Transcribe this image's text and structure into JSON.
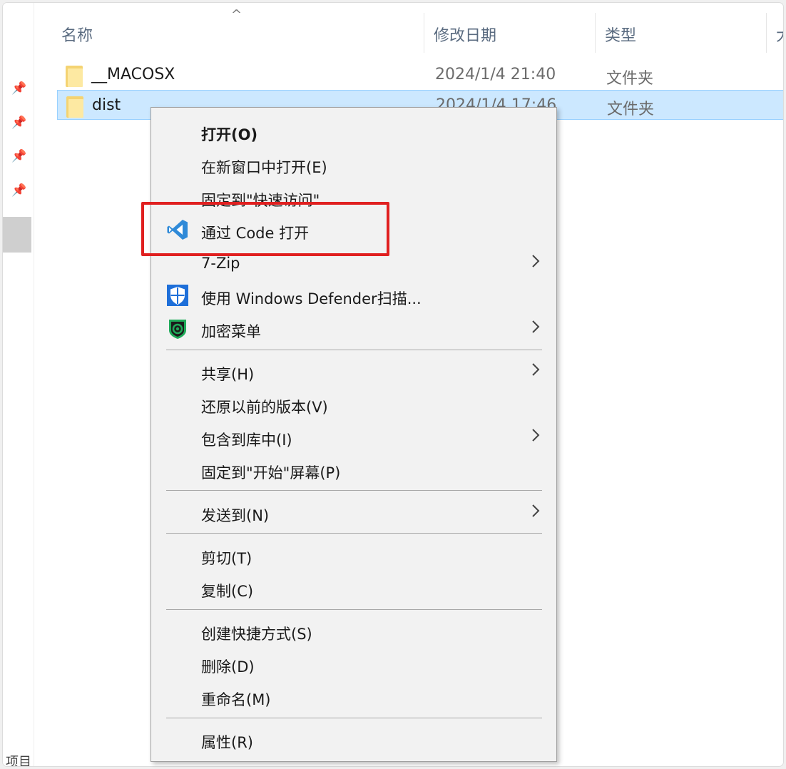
{
  "columns": {
    "name": "名称",
    "date": "修改日期",
    "type": "类型",
    "size_cut": "大"
  },
  "files": [
    {
      "name": "__MACOSX",
      "date": "2024/1/4 21:40",
      "type": "文件夹",
      "selected": false
    },
    {
      "name": "dist",
      "date": "2024/1/4 17:46",
      "type": "文件夹",
      "selected": true
    }
  ],
  "nav_cut_text": "项目",
  "context_menu": {
    "open": "打开(O)",
    "open_new_window": "在新窗口中打开(E)",
    "pin_quick_access": "固定到\"快速访问\"",
    "open_with_code": "通过 Code 打开",
    "seven_zip": "7-Zip",
    "defender_scan": "使用 Windows Defender扫描...",
    "encrypt_menu": "加密菜单",
    "share": "共享(H)",
    "restore_versions": "还原以前的版本(V)",
    "include_library": "包含到库中(I)",
    "pin_start": "固定到\"开始\"屏幕(P)",
    "send_to": "发送到(N)",
    "cut": "剪切(T)",
    "copy": "复制(C)",
    "create_shortcut": "创建快捷方式(S)",
    "delete": "删除(D)",
    "rename": "重命名(M)",
    "properties": "属性(R)"
  },
  "colors": {
    "highlight": "#e02020",
    "selection": "#cce8ff",
    "vscode_blue": "#2f8ad8",
    "defender_blue": "#1e6fd9",
    "encrypt_green": "#1faa59"
  },
  "icons": {
    "pin": "pin-icon",
    "folder": "folder-icon",
    "vscode": "vscode-icon",
    "defender": "shield-icon",
    "encrypt": "encrypt-icon",
    "submenu": "chevron-right-icon",
    "sort": "chevron-up-icon"
  }
}
